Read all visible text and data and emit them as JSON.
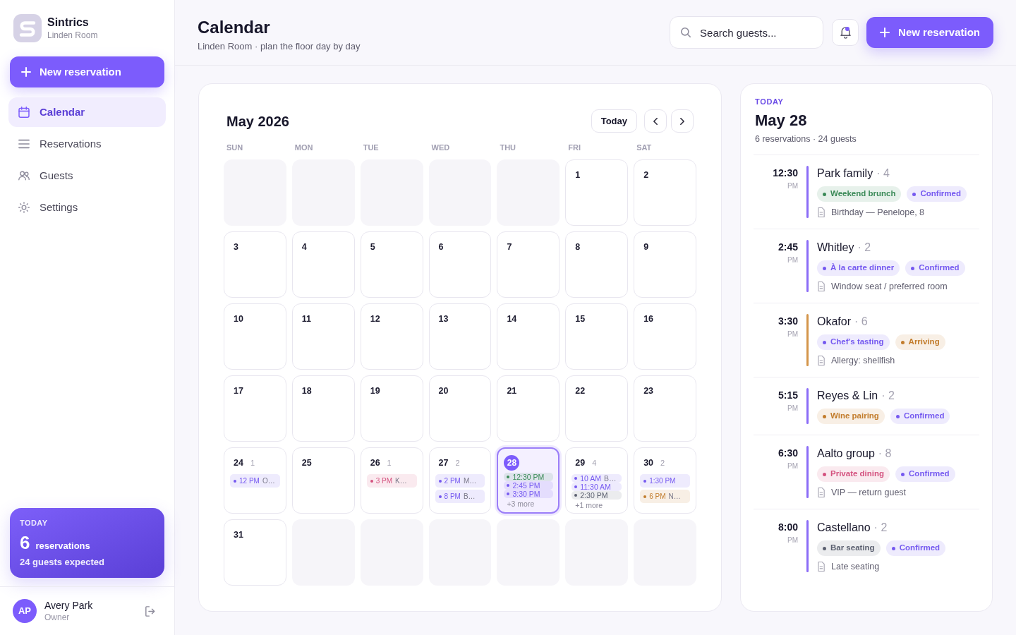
{
  "sidebar": {
    "brand": {
      "name": "Sintrics",
      "subtitle": "Linden Room"
    },
    "new_button": "New reservation",
    "nav": [
      {
        "label": "Calendar",
        "kind": "calendar",
        "selected": true
      },
      {
        "label": "Reservations",
        "kind": "list",
        "selected": false
      },
      {
        "label": "Guests",
        "kind": "guests",
        "selected": false
      },
      {
        "label": "Settings",
        "kind": "settings",
        "selected": false
      }
    ],
    "today_card": {
      "label": "TODAY",
      "count": "6",
      "unit": "reservations",
      "detail": "24 guests expected"
    },
    "user": {
      "initials": "AP",
      "name": "Avery Park",
      "role": "Owner"
    }
  },
  "header": {
    "title": "Calendar",
    "subtitle": "Linden Room · plan the floor day by day",
    "search": {
      "placeholder": "Search guests..."
    },
    "notifications": {
      "unread": true
    },
    "new_button": "New reservation"
  },
  "calendar": {
    "title": "May 2026",
    "today_button": "Today",
    "weekdays": [
      "SUN",
      "MON",
      "TUE",
      "WED",
      "THU",
      "FRI",
      "SAT"
    ],
    "weeks": [
      [
        {
          "kind": "blank"
        },
        {
          "kind": "blank"
        },
        {
          "kind": "blank"
        },
        {
          "kind": "blank"
        },
        {
          "kind": "blank"
        },
        {
          "kind": "day",
          "day": "1",
          "selected": false
        },
        {
          "kind": "day",
          "day": "2",
          "selected": false
        }
      ],
      [
        {
          "kind": "day",
          "day": "3",
          "selected": false
        },
        {
          "kind": "day",
          "day": "4",
          "selected": false
        },
        {
          "kind": "day",
          "day": "5",
          "selected": false
        },
        {
          "kind": "day",
          "day": "6",
          "selected": false
        },
        {
          "kind": "day",
          "day": "7",
          "selected": false
        },
        {
          "kind": "day",
          "day": "8",
          "selected": false
        },
        {
          "kind": "day",
          "day": "9",
          "selected": false
        }
      ],
      [
        {
          "kind": "day",
          "day": "10",
          "selected": false
        },
        {
          "kind": "day",
          "day": "11",
          "selected": false
        },
        {
          "kind": "day",
          "day": "12",
          "selected": false
        },
        {
          "kind": "day",
          "day": "13",
          "selected": false
        },
        {
          "kind": "day",
          "day": "14",
          "selected": false
        },
        {
          "kind": "day",
          "day": "15",
          "selected": false
        },
        {
          "kind": "day",
          "day": "16",
          "selected": false
        }
      ],
      [
        {
          "kind": "day",
          "day": "17",
          "selected": false
        },
        {
          "kind": "day",
          "day": "18",
          "selected": false
        },
        {
          "kind": "day",
          "day": "19",
          "selected": false
        },
        {
          "kind": "day",
          "day": "20",
          "selected": false
        },
        {
          "kind": "day",
          "day": "21",
          "selected": false
        },
        {
          "kind": "day",
          "day": "22",
          "selected": false
        },
        {
          "kind": "day",
          "day": "23",
          "selected": false
        }
      ],
      [
        {
          "kind": "day",
          "day": "24",
          "selected": false,
          "count": "1",
          "events": [
            {
              "time": "12 PM",
              "title": "O…",
              "color": "#7559f0"
            }
          ]
        },
        {
          "kind": "day",
          "day": "25",
          "selected": false
        },
        {
          "kind": "day",
          "day": "26",
          "selected": false,
          "count": "1",
          "events": [
            {
              "time": "3 PM",
              "title": "K…",
              "color": "#d4527f"
            }
          ]
        },
        {
          "kind": "day",
          "day": "27",
          "selected": false,
          "count": "2",
          "events": [
            {
              "time": "2 PM",
              "title": "M…",
              "color": "#7559f0"
            },
            {
              "time": "8 PM",
              "title": "B…",
              "color": "#7559f0"
            }
          ]
        },
        {
          "kind": "day",
          "day": "28",
          "selected": true,
          "events": [
            {
              "time": "12:30 PM",
              "color": "#3b8a58"
            },
            {
              "time": "2:45 PM",
              "color": "#7559f0"
            },
            {
              "time": "3:30 PM",
              "color": "#7559f0"
            }
          ],
          "more": "+3 more"
        },
        {
          "kind": "day",
          "day": "29",
          "selected": false,
          "count": "4",
          "events": [
            {
              "time": "10 AM",
              "title": "B…",
              "color": "#7559f0"
            },
            {
              "time": "11:30 AM",
              "color": "#7559f0"
            },
            {
              "time": "2:30 PM",
              "color": "#5b6070"
            }
          ],
          "more": "+1 more"
        },
        {
          "kind": "day",
          "day": "30",
          "selected": false,
          "count": "2",
          "events": [
            {
              "time": "1:30 PM",
              "color": "#7559f0"
            },
            {
              "time": "6 PM",
              "title": "N…",
              "color": "#c27c2c"
            }
          ]
        }
      ],
      [
        {
          "kind": "day",
          "day": "31",
          "selected": false
        },
        {
          "kind": "blank"
        },
        {
          "kind": "blank"
        },
        {
          "kind": "blank"
        },
        {
          "kind": "blank"
        },
        {
          "kind": "blank"
        },
        {
          "kind": "blank"
        }
      ]
    ]
  },
  "agenda": {
    "label": "TODAY",
    "title": "May 28",
    "summary": "6 reservations · 24 guests",
    "reservations": [
      {
        "time": "12:30",
        "period": "PM",
        "name": "Park family",
        "party": "· 4",
        "color": "#8b6cf7",
        "tags": [
          {
            "label": "Weekend brunch",
            "color": "#3b8a58"
          },
          {
            "label": "Confirmed",
            "color": "#7559f0"
          }
        ],
        "note": "Birthday — Penelope, 8"
      },
      {
        "time": "2:45",
        "period": "PM",
        "name": "Whitley",
        "party": "· 2",
        "color": "#8b6cf7",
        "tags": [
          {
            "label": "À la carte dinner",
            "color": "#7559f0"
          },
          {
            "label": "Confirmed",
            "color": "#7559f0"
          }
        ],
        "note": "Window seat / preferred room"
      },
      {
        "time": "3:30",
        "period": "PM",
        "name": "Okafor",
        "party": "· 6",
        "color": "#d4954a",
        "tags": [
          {
            "label": "Chef's tasting",
            "color": "#7559f0"
          },
          {
            "label": "Arriving",
            "color": "#c27c2c"
          }
        ],
        "note": "Allergy: shellfish"
      },
      {
        "time": "5:15",
        "period": "PM",
        "name": "Reyes & Lin",
        "party": "· 2",
        "color": "#8b6cf7",
        "tags": [
          {
            "label": "Wine pairing",
            "color": "#c27c2c"
          },
          {
            "label": "Confirmed",
            "color": "#7559f0"
          }
        ]
      },
      {
        "time": "6:30",
        "period": "PM",
        "name": "Aalto group",
        "party": "· 8",
        "color": "#8b6cf7",
        "tags": [
          {
            "label": "Private dining",
            "color": "#d4527f"
          },
          {
            "label": "Confirmed",
            "color": "#7559f0"
          }
        ],
        "note": "VIP — return guest"
      },
      {
        "time": "8:00",
        "period": "PM",
        "name": "Castellano",
        "party": "· 2",
        "color": "#8b6cf7",
        "tags": [
          {
            "label": "Bar seating",
            "color": "#5b6070"
          },
          {
            "label": "Confirmed",
            "color": "#7559f0"
          }
        ],
        "note": "Late seating"
      }
    ]
  }
}
